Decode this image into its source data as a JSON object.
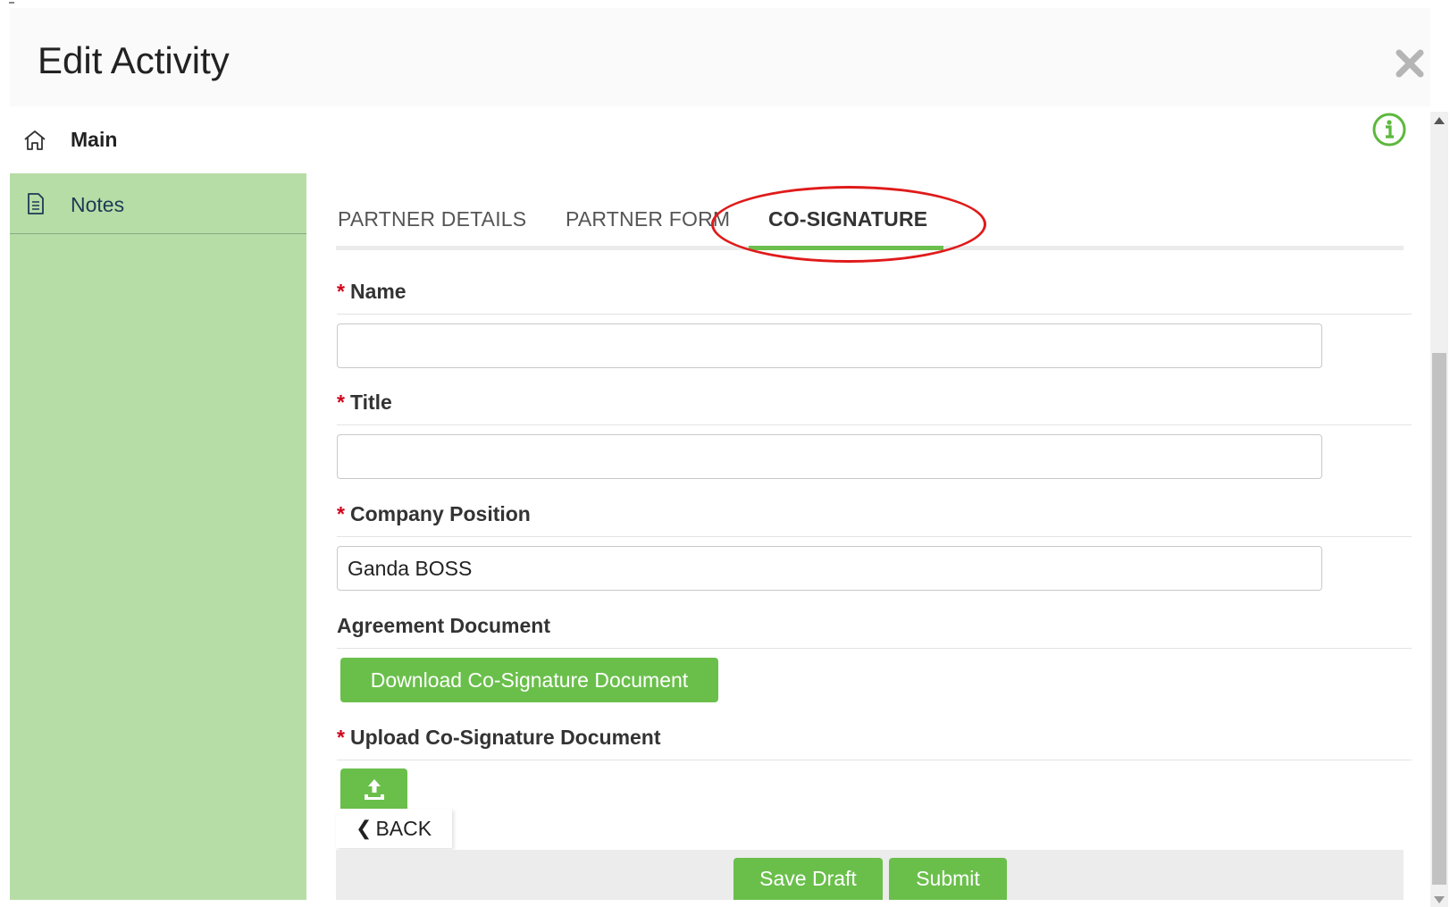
{
  "dialog": {
    "title": "Edit Activity",
    "close_icon": "close-icon"
  },
  "sidebar": {
    "items": [
      {
        "label": "Main",
        "icon": "home-icon"
      },
      {
        "label": "Notes",
        "icon": "document-icon"
      }
    ]
  },
  "tabs": [
    {
      "label": "PARTNER DETAILS",
      "active": false
    },
    {
      "label": "PARTNER FORM",
      "active": false
    },
    {
      "label": "CO-SIGNATURE",
      "active": true
    }
  ],
  "form": {
    "required_marker": "*",
    "name": {
      "label": "Name",
      "value": "",
      "required": true
    },
    "title": {
      "label": "Title",
      "value": "",
      "required": true
    },
    "company_position": {
      "label": "Company Position",
      "value": "Ganda BOSS",
      "required": true
    },
    "agreement_document": {
      "label": "Agreement Document",
      "button_label": "Download Co-Signature Document"
    },
    "upload": {
      "label": "Upload Co-Signature Document",
      "required": true,
      "icon": "upload-icon"
    }
  },
  "actions": {
    "back_label": "BACK",
    "save_draft_label": "Save Draft",
    "submit_label": "Submit"
  },
  "colors": {
    "accent_green": "#6abf4b",
    "sidebar_green": "#b6dda6",
    "required_red": "#d0021b",
    "annotation_red": "#e01a1a"
  }
}
